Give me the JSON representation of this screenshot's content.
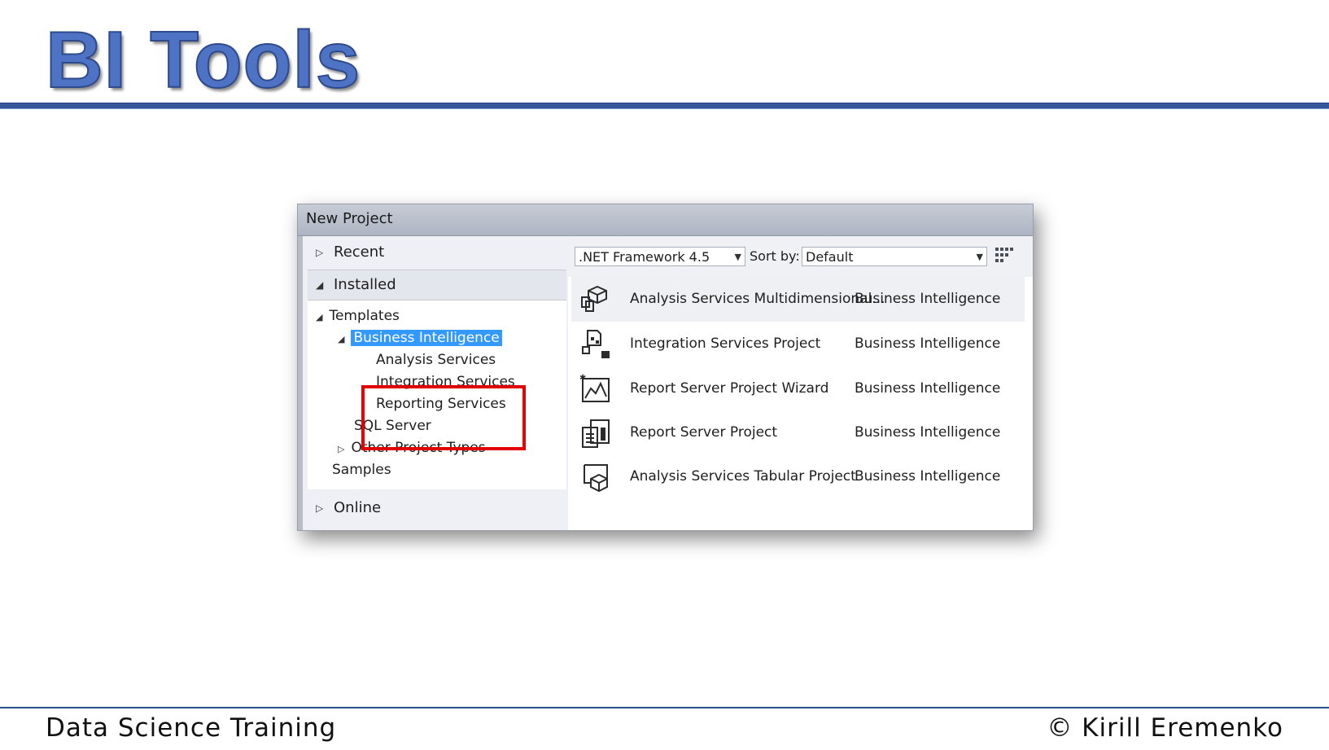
{
  "slide": {
    "title": "BI Tools",
    "footer_left": "Data Science Training",
    "footer_right": "© Kirill Eremenko"
  },
  "dialog": {
    "title": "New Project",
    "sections": {
      "recent": "Recent",
      "installed": "Installed",
      "online": "Online"
    },
    "tree": {
      "templates": "Templates",
      "business_intelligence": "Business Intelligence",
      "analysis_services": "Analysis Services",
      "integration_services": "Integration Services",
      "reporting_services": "Reporting Services",
      "sql_server": "SQL Server",
      "other_project_types": "Other Project Types",
      "samples": "Samples"
    },
    "toolbar": {
      "framework": ".NET Framework 4.5",
      "sort_label": "Sort by:",
      "sort_value": "Default"
    },
    "templates": [
      {
        "name": "Analysis Services Multidimensional...",
        "category": "Business Intelligence",
        "icon": "analysis-multidimensional-icon"
      },
      {
        "name": "Integration Services Project",
        "category": "Business Intelligence",
        "icon": "integration-services-icon"
      },
      {
        "name": "Report Server Project Wizard",
        "category": "Business Intelligence",
        "icon": "report-wizard-icon"
      },
      {
        "name": "Report Server Project",
        "category": "Business Intelligence",
        "icon": "report-server-icon"
      },
      {
        "name": "Analysis Services Tabular Project",
        "category": "Business Intelligence",
        "icon": "analysis-tabular-icon"
      }
    ],
    "highlight_color": "#e00000",
    "selection_color": "#3399ff"
  }
}
